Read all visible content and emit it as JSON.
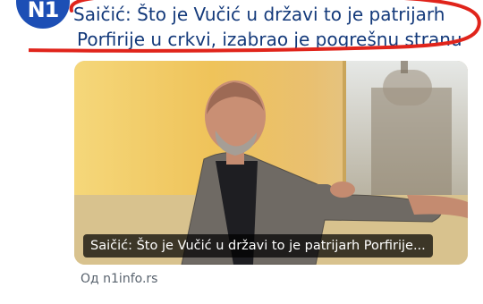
{
  "post": {
    "logo_text": "N1",
    "headline_line1": "Saičić: Što je Vučić u državi to je patrijarh",
    "headline_line2": "Porfirije u crkvi, izabrao je pogrešnu stranu"
  },
  "link_card": {
    "caption": "Saičić: Što je Vučić u državi to je patrijarh Porfirije...",
    "source": "Од n1info.rs"
  },
  "colors": {
    "headline": "#13397a",
    "annotation": "#e0241b",
    "logo": "#1d4fb5",
    "source": "#59636e"
  },
  "icons": [
    "n1-logo"
  ]
}
